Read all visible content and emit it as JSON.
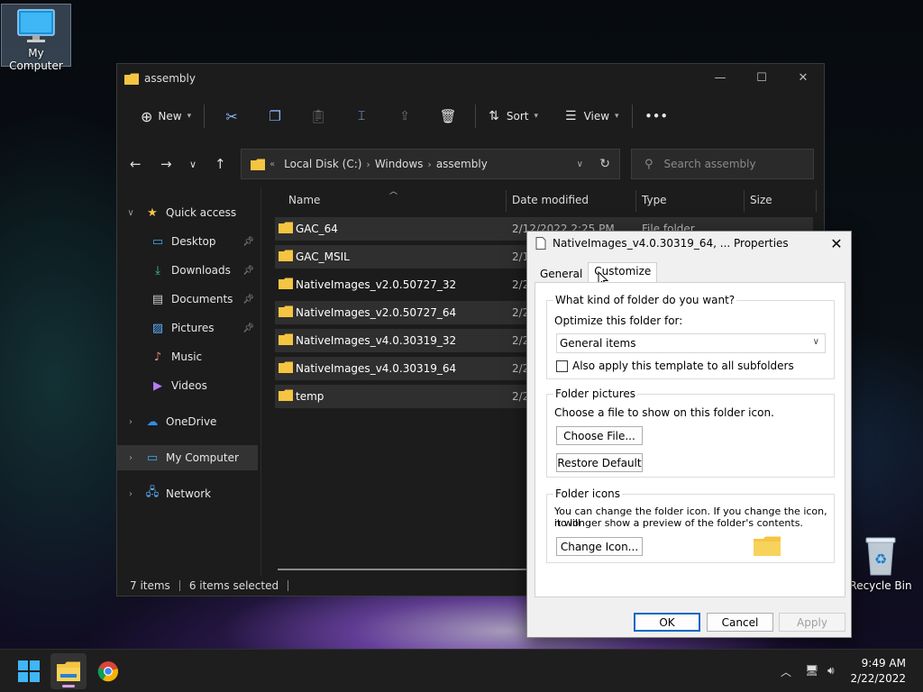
{
  "desktop": {
    "my_computer_label": "My Computer",
    "recycle_bin_label": "Recycle Bin"
  },
  "explorer": {
    "title": "assembly",
    "toolbar": {
      "new_label": "New",
      "sort_label": "Sort",
      "view_label": "View",
      "more_label": "•••"
    },
    "address": {
      "crumbs": [
        "Local Disk (C:)",
        "Windows",
        "assembly"
      ],
      "overflow": "«"
    },
    "search_placeholder": "Search assembly",
    "sidebar": {
      "quick_access": "Quick access",
      "items": [
        {
          "label": "Desktop",
          "icon": "desktop-icon",
          "pinned": true
        },
        {
          "label": "Downloads",
          "icon": "downloads-icon",
          "pinned": true
        },
        {
          "label": "Documents",
          "icon": "documents-icon",
          "pinned": true
        },
        {
          "label": "Pictures",
          "icon": "pictures-icon",
          "pinned": true
        },
        {
          "label": "Music",
          "icon": "music-icon",
          "pinned": false
        },
        {
          "label": "Videos",
          "icon": "videos-icon",
          "pinned": false
        }
      ],
      "onedrive": "OneDrive",
      "my_computer": "My Computer",
      "network": "Network"
    },
    "columns": [
      "Name",
      "Date modified",
      "Type",
      "Size"
    ],
    "rows": [
      {
        "name": "GAC_64",
        "date": "2/12/2022 2:25 PM",
        "type": "File folder"
      },
      {
        "name": "GAC_MSIL",
        "date": "2/1",
        "type": ""
      },
      {
        "name": "NativeImages_v2.0.50727_32",
        "date": "2/2",
        "type": ""
      },
      {
        "name": "NativeImages_v2.0.50727_64",
        "date": "2/2",
        "type": ""
      },
      {
        "name": "NativeImages_v4.0.30319_32",
        "date": "2/2",
        "type": ""
      },
      {
        "name": "NativeImages_v4.0.30319_64",
        "date": "2/2",
        "type": ""
      },
      {
        "name": "temp",
        "date": "2/2",
        "type": ""
      }
    ],
    "status": {
      "items": "7 items",
      "selected": "6 items selected"
    }
  },
  "dialog": {
    "title": "NativeImages_v4.0.30319_64, ... Properties",
    "tabs": [
      "General",
      "Customize"
    ],
    "kind_group": "What kind of folder do you want?",
    "optimize_label": "Optimize this folder for:",
    "optimize_value": "General items",
    "apply_label": "Also apply this template to all subfolders",
    "pictures_group": "Folder pictures",
    "pictures_desc": "Choose a file to show on this folder icon.",
    "choose_file": "Choose File...",
    "restore_default": "Restore Default",
    "icons_group": "Folder icons",
    "icons_desc_1": "You can change the folder icon. If you change the icon, it will",
    "icons_desc_2": "no longer show a preview of the folder's contents.",
    "change_icon": "Change Icon...",
    "ok": "OK",
    "cancel": "Cancel",
    "apply": "Apply"
  },
  "taskbar": {
    "time": "9:49 AM",
    "date": "2/22/2022"
  },
  "colors": {
    "folder": "#f5c542",
    "accent": "#0067c0",
    "explorer_bg": "#1c1c1c"
  }
}
